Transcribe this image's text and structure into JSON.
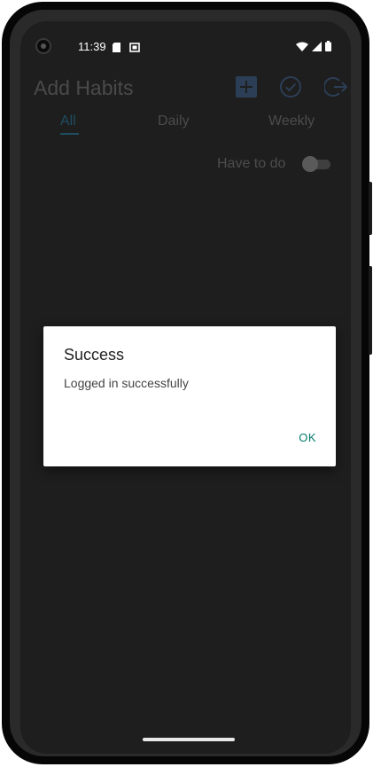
{
  "status_bar": {
    "time": "11:39"
  },
  "app_bar": {
    "title": "Add Habits",
    "actions": [
      {
        "icon": "add-box-icon",
        "color": "#2c3e55"
      },
      {
        "icon": "check-circle-icon",
        "color": "#2c3e55"
      },
      {
        "icon": "logout-icon",
        "color": "#2c3e55"
      }
    ]
  },
  "tabs": [
    {
      "label": "All",
      "active": true
    },
    {
      "label": "Daily",
      "active": false
    },
    {
      "label": "Weekly",
      "active": false
    }
  ],
  "filter": {
    "label": "Have to do",
    "enabled": false
  },
  "dialog": {
    "title": "Success",
    "message": "Logged in successfully",
    "ok_label": "OK"
  },
  "colors": {
    "accent": "#1f4d60",
    "dialog_button": "#00796b",
    "background": "#1e1e1e"
  }
}
